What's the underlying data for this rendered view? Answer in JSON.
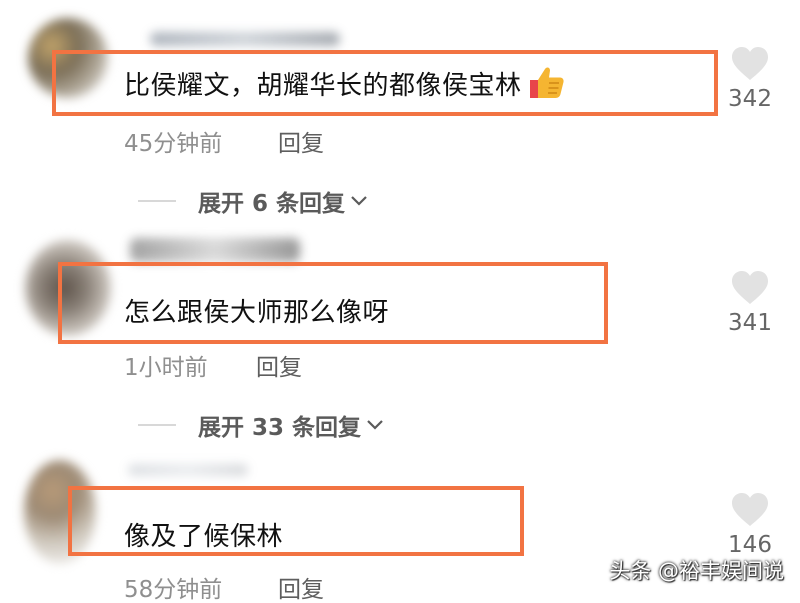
{
  "comments": [
    {
      "text": "比侯耀文，胡耀华长的都像侯宝林",
      "emoji": "thumbs-up-emoji",
      "time": "45分钟前",
      "reply_label": "回复",
      "expand_label": "展开 6 条回复",
      "likes": "342"
    },
    {
      "text": "怎么跟侯大师那么像呀",
      "time": "1小时前",
      "reply_label": "回复",
      "expand_label": "展开 33 条回复",
      "likes": "341"
    },
    {
      "text": "像及了候保林",
      "time": "58分钟前",
      "reply_label": "回复",
      "likes": "146"
    }
  ],
  "watermark": "头条 @裕丰娱间说",
  "colors": {
    "highlight_border": "#f27342",
    "heart": "#e2e2e2",
    "text_primary": "#111111",
    "text_meta": "#8f8f8f"
  }
}
